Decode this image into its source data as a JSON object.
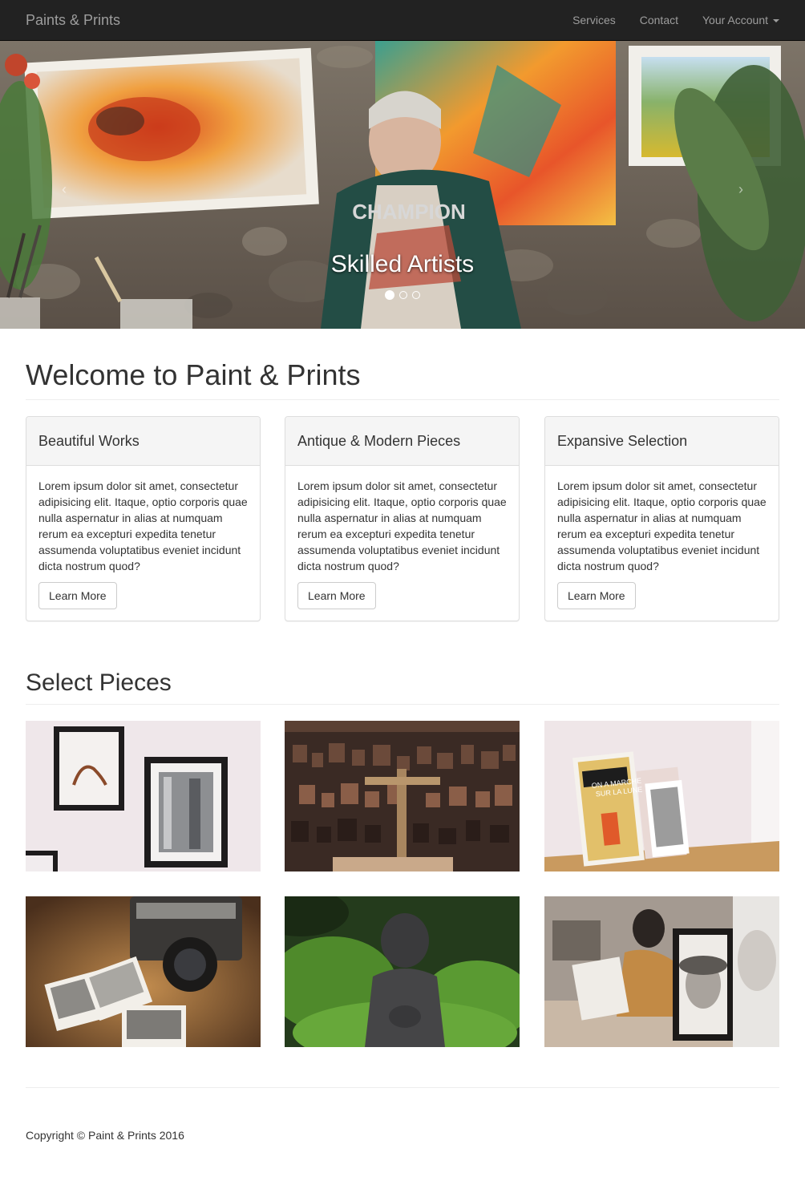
{
  "navbar": {
    "brand": "Paints & Prints",
    "links": [
      "Services",
      "Contact",
      "Your Account"
    ]
  },
  "carousel": {
    "caption": "Skilled Artists",
    "slide_count": 3,
    "active_slide": 1,
    "prev_glyph": "‹",
    "next_glyph": "›"
  },
  "welcome": {
    "heading": "Welcome to Paint & Prints"
  },
  "panels": [
    {
      "title": "Beautiful Works",
      "body": "Lorem ipsum dolor sit amet, consectetur adipisicing elit. Itaque, optio corporis quae nulla aspernatur in alias at numquam rerum ea excepturi expedita tenetur assumenda voluptatibus eveniet incidunt dicta nostrum quod?",
      "button": "Learn More"
    },
    {
      "title": "Antique & Modern Pieces",
      "body": "Lorem ipsum dolor sit amet, consectetur adipisicing elit. Itaque, optio corporis quae nulla aspernatur in alias at numquam rerum ea excepturi expedita tenetur assumenda voluptatibus eveniet incidunt dicta nostrum quod?",
      "button": "Learn More"
    },
    {
      "title": "Expansive Selection",
      "body": "Lorem ipsum dolor sit amet, consectetur adipisicing elit. Itaque, optio corporis quae nulla aspernatur in alias at numquam rerum ea excepturi expedita tenetur assumenda voluptatibus eveniet incidunt dicta nostrum quod?",
      "button": "Learn More"
    }
  ],
  "gallery": {
    "heading": "Select Pieces",
    "items": [
      "framed-prints-photo",
      "letterpress-type-blocks-photo",
      "vintage-posters-photo",
      "camera-and-polaroids-photo",
      "stone-statue-photo",
      "portrait-sketch-artist-photo"
    ]
  },
  "footer": {
    "copyright": "Copyright © Paint & Prints 2016"
  },
  "colors": {
    "navbar_bg": "#222222",
    "navbar_text": "#9d9d9d",
    "panel_heading_bg": "#f5f5f5",
    "border": "#dddddd"
  }
}
